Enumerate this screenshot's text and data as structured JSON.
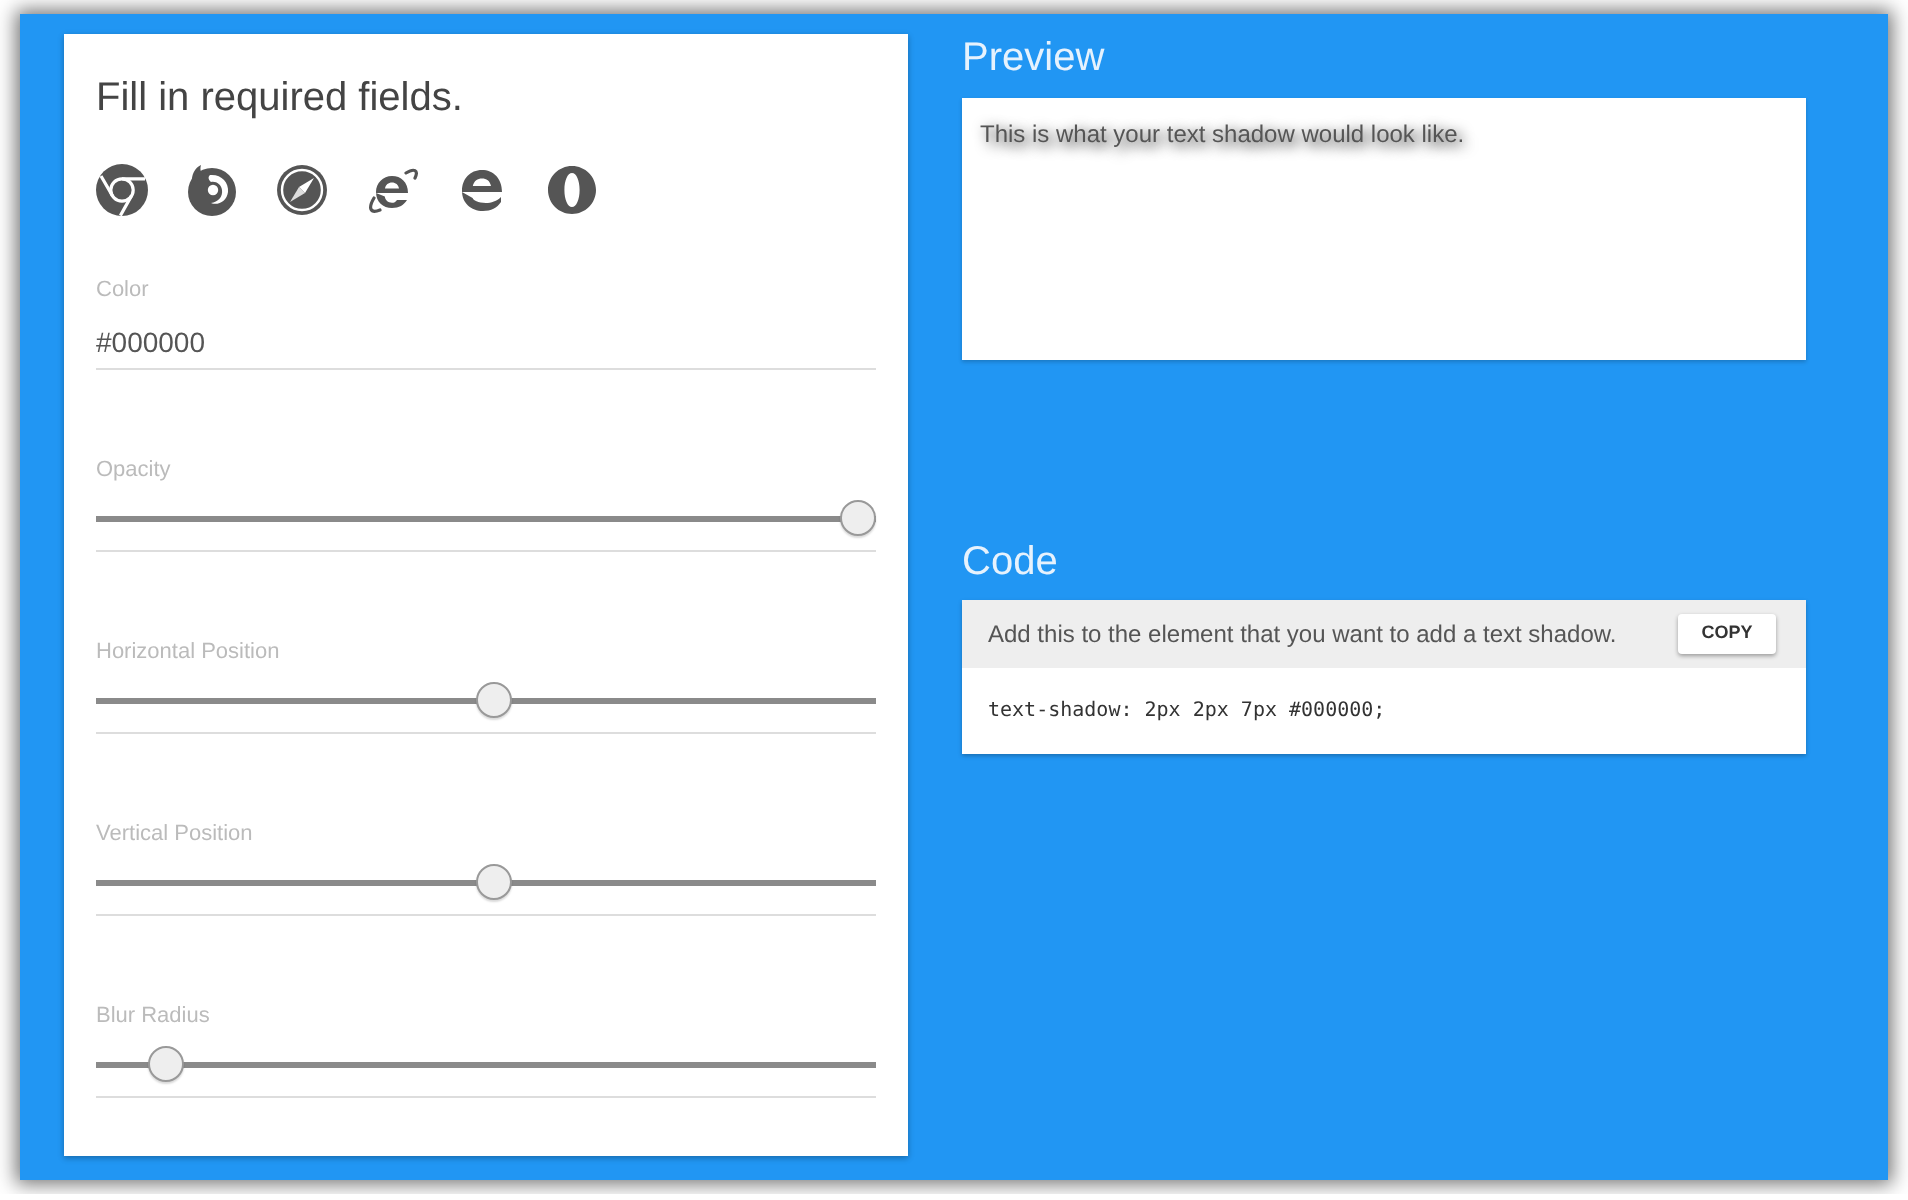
{
  "form": {
    "title": "Fill in required fields.",
    "color_field": {
      "label": "Color",
      "value": "#000000"
    },
    "sliders": [
      {
        "label": "Opacity",
        "level": 1
      },
      {
        "label": "Horizontal Position",
        "level": 0.51
      },
      {
        "label": "Vertical Position",
        "level": 0.51
      },
      {
        "label": "Blur Radius",
        "level": 0.07
      }
    ]
  },
  "preview": {
    "heading": "Preview",
    "text": "This is what your text shadow would look like."
  },
  "code": {
    "heading": "Code",
    "instruction": "Add this to the element that you want to add a text shadow.",
    "copy_button": "COPY",
    "snippet": "text-shadow: 2px 2px 7px #000000;"
  }
}
